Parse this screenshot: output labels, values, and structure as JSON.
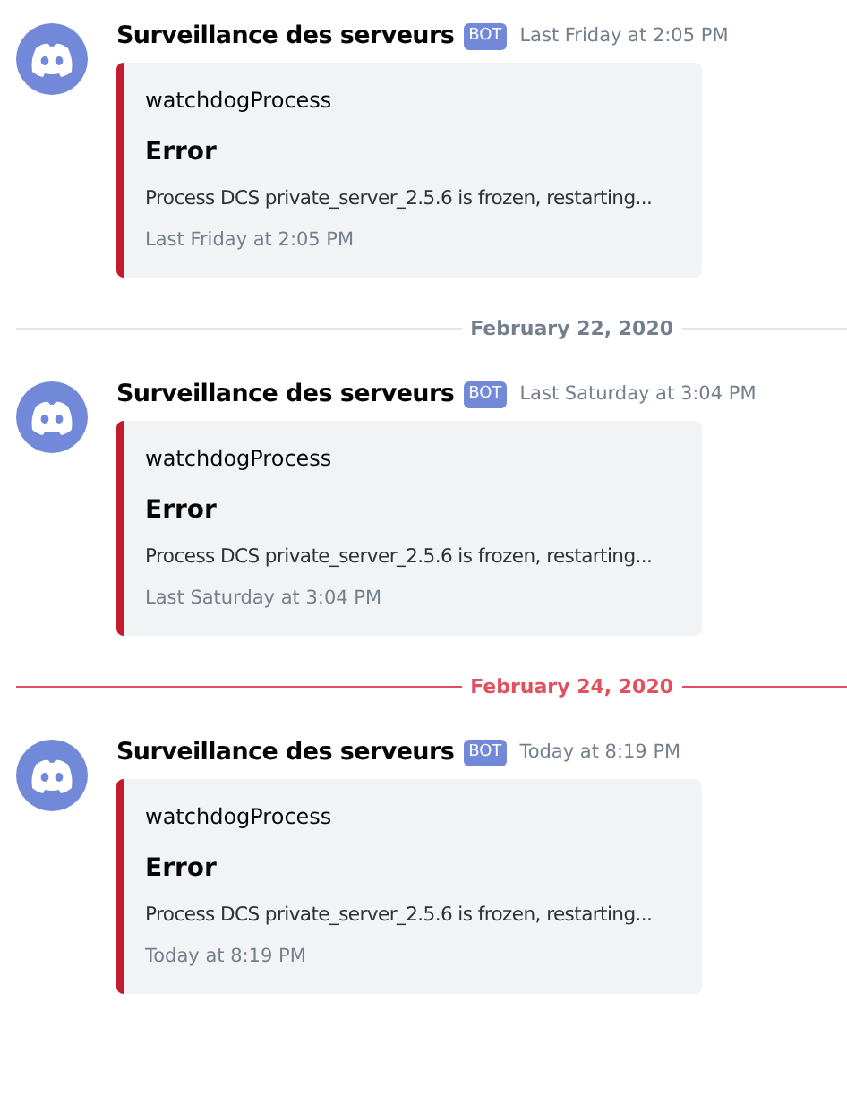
{
  "messages": [
    {
      "author": "Surveillance des serveurs",
      "badge": "BOT",
      "timestamp": "Last Friday at 2:05 PM",
      "embed": {
        "author": "watchdogProcess",
        "title": "Error",
        "description": "Process DCS private_server_2.5.6 is frozen, restarting...",
        "footer": "Last Friday at 2:05 PM"
      }
    },
    {
      "divider": {
        "label": "February 22, 2020",
        "unread": false
      },
      "author": "Surveillance des serveurs",
      "badge": "BOT",
      "timestamp": "Last Saturday at 3:04 PM",
      "embed": {
        "author": "watchdogProcess",
        "title": "Error",
        "description": "Process DCS private_server_2.5.6 is frozen, restarting...",
        "footer": "Last Saturday at 3:04 PM"
      }
    },
    {
      "divider": {
        "label": "February 24, 2020",
        "unread": true
      },
      "author": "Surveillance des serveurs",
      "badge": "BOT",
      "timestamp": "Today at 8:19 PM",
      "embed": {
        "author": "watchdogProcess",
        "title": "Error",
        "description": "Process DCS private_server_2.5.6 is frozen, restarting...",
        "footer": "Today at 8:19 PM"
      }
    }
  ]
}
